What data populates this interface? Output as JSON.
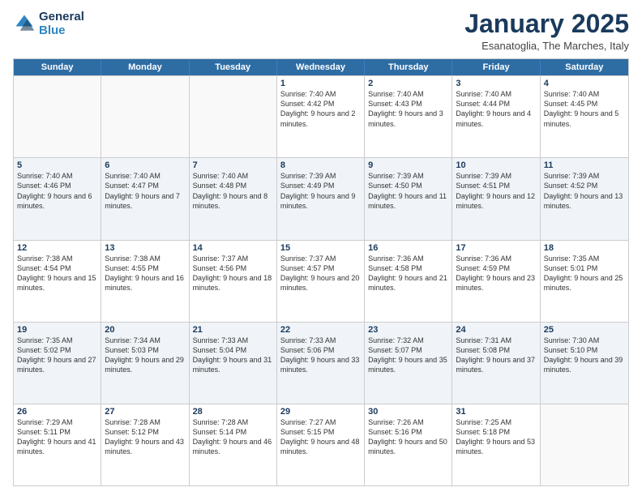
{
  "logo": {
    "line1": "General",
    "line2": "Blue"
  },
  "title": "January 2025",
  "subtitle": "Esanatoglia, The Marches, Italy",
  "days": [
    "Sunday",
    "Monday",
    "Tuesday",
    "Wednesday",
    "Thursday",
    "Friday",
    "Saturday"
  ],
  "rows": [
    [
      {
        "day": "",
        "text": ""
      },
      {
        "day": "",
        "text": ""
      },
      {
        "day": "",
        "text": ""
      },
      {
        "day": "1",
        "text": "Sunrise: 7:40 AM\nSunset: 4:42 PM\nDaylight: 9 hours and 2 minutes."
      },
      {
        "day": "2",
        "text": "Sunrise: 7:40 AM\nSunset: 4:43 PM\nDaylight: 9 hours and 3 minutes."
      },
      {
        "day": "3",
        "text": "Sunrise: 7:40 AM\nSunset: 4:44 PM\nDaylight: 9 hours and 4 minutes."
      },
      {
        "day": "4",
        "text": "Sunrise: 7:40 AM\nSunset: 4:45 PM\nDaylight: 9 hours and 5 minutes."
      }
    ],
    [
      {
        "day": "5",
        "text": "Sunrise: 7:40 AM\nSunset: 4:46 PM\nDaylight: 9 hours and 6 minutes."
      },
      {
        "day": "6",
        "text": "Sunrise: 7:40 AM\nSunset: 4:47 PM\nDaylight: 9 hours and 7 minutes."
      },
      {
        "day": "7",
        "text": "Sunrise: 7:40 AM\nSunset: 4:48 PM\nDaylight: 9 hours and 8 minutes."
      },
      {
        "day": "8",
        "text": "Sunrise: 7:39 AM\nSunset: 4:49 PM\nDaylight: 9 hours and 9 minutes."
      },
      {
        "day": "9",
        "text": "Sunrise: 7:39 AM\nSunset: 4:50 PM\nDaylight: 9 hours and 11 minutes."
      },
      {
        "day": "10",
        "text": "Sunrise: 7:39 AM\nSunset: 4:51 PM\nDaylight: 9 hours and 12 minutes."
      },
      {
        "day": "11",
        "text": "Sunrise: 7:39 AM\nSunset: 4:52 PM\nDaylight: 9 hours and 13 minutes."
      }
    ],
    [
      {
        "day": "12",
        "text": "Sunrise: 7:38 AM\nSunset: 4:54 PM\nDaylight: 9 hours and 15 minutes."
      },
      {
        "day": "13",
        "text": "Sunrise: 7:38 AM\nSunset: 4:55 PM\nDaylight: 9 hours and 16 minutes."
      },
      {
        "day": "14",
        "text": "Sunrise: 7:37 AM\nSunset: 4:56 PM\nDaylight: 9 hours and 18 minutes."
      },
      {
        "day": "15",
        "text": "Sunrise: 7:37 AM\nSunset: 4:57 PM\nDaylight: 9 hours and 20 minutes."
      },
      {
        "day": "16",
        "text": "Sunrise: 7:36 AM\nSunset: 4:58 PM\nDaylight: 9 hours and 21 minutes."
      },
      {
        "day": "17",
        "text": "Sunrise: 7:36 AM\nSunset: 4:59 PM\nDaylight: 9 hours and 23 minutes."
      },
      {
        "day": "18",
        "text": "Sunrise: 7:35 AM\nSunset: 5:01 PM\nDaylight: 9 hours and 25 minutes."
      }
    ],
    [
      {
        "day": "19",
        "text": "Sunrise: 7:35 AM\nSunset: 5:02 PM\nDaylight: 9 hours and 27 minutes."
      },
      {
        "day": "20",
        "text": "Sunrise: 7:34 AM\nSunset: 5:03 PM\nDaylight: 9 hours and 29 minutes."
      },
      {
        "day": "21",
        "text": "Sunrise: 7:33 AM\nSunset: 5:04 PM\nDaylight: 9 hours and 31 minutes."
      },
      {
        "day": "22",
        "text": "Sunrise: 7:33 AM\nSunset: 5:06 PM\nDaylight: 9 hours and 33 minutes."
      },
      {
        "day": "23",
        "text": "Sunrise: 7:32 AM\nSunset: 5:07 PM\nDaylight: 9 hours and 35 minutes."
      },
      {
        "day": "24",
        "text": "Sunrise: 7:31 AM\nSunset: 5:08 PM\nDaylight: 9 hours and 37 minutes."
      },
      {
        "day": "25",
        "text": "Sunrise: 7:30 AM\nSunset: 5:10 PM\nDaylight: 9 hours and 39 minutes."
      }
    ],
    [
      {
        "day": "26",
        "text": "Sunrise: 7:29 AM\nSunset: 5:11 PM\nDaylight: 9 hours and 41 minutes."
      },
      {
        "day": "27",
        "text": "Sunrise: 7:28 AM\nSunset: 5:12 PM\nDaylight: 9 hours and 43 minutes."
      },
      {
        "day": "28",
        "text": "Sunrise: 7:28 AM\nSunset: 5:14 PM\nDaylight: 9 hours and 46 minutes."
      },
      {
        "day": "29",
        "text": "Sunrise: 7:27 AM\nSunset: 5:15 PM\nDaylight: 9 hours and 48 minutes."
      },
      {
        "day": "30",
        "text": "Sunrise: 7:26 AM\nSunset: 5:16 PM\nDaylight: 9 hours and 50 minutes."
      },
      {
        "day": "31",
        "text": "Sunrise: 7:25 AM\nSunset: 5:18 PM\nDaylight: 9 hours and 53 minutes."
      },
      {
        "day": "",
        "text": ""
      }
    ]
  ]
}
